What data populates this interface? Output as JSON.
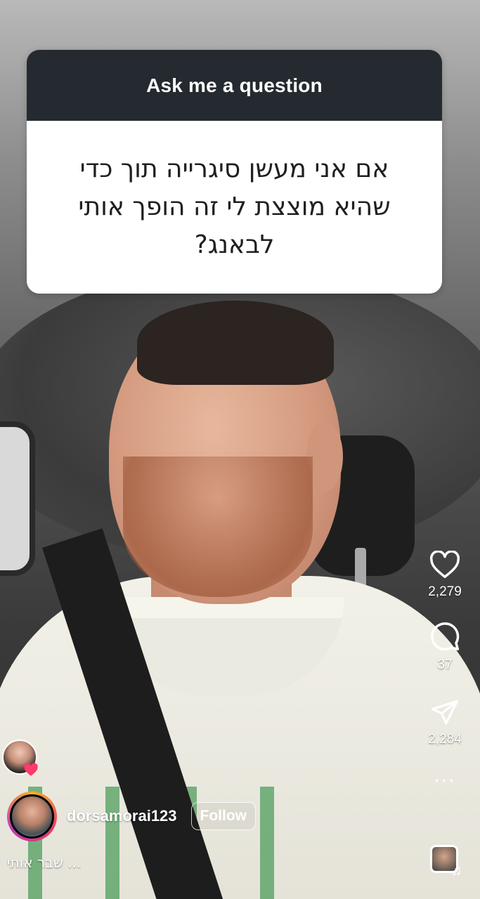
{
  "sticker": {
    "title": "Ask me a question",
    "question": "אם אני מעשן סיגרייה תוך כדי שהיא מוצצת לי זה הופך אותי לבאנג?"
  },
  "actions": {
    "likes": "2,279",
    "comments": "37",
    "shares": "2,284",
    "more": "..."
  },
  "user": {
    "username": "dorsamorai123",
    "follow_label": "Follow",
    "caption": "שבר אותי ..."
  },
  "icons": {
    "like": "heart-icon",
    "comment": "comment-icon",
    "share": "send-icon",
    "more": "more-dots-icon",
    "audio": "music-note-icon"
  },
  "colors": {
    "sticker_header": "#252a30",
    "sticker_body": "#ffffff",
    "avatar_ring": [
      "#f6b12a",
      "#e33b66",
      "#c13ab5"
    ],
    "liker_heart": "#ff3b6b"
  }
}
